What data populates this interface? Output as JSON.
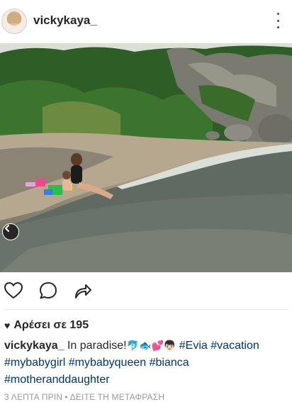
{
  "post": {
    "username": "vickykaya_",
    "likes_label": "Αρέσει σε 195",
    "caption": {
      "username": "vickykaya_",
      "text": "In paradise!",
      "emojis": "🐬🐟💕👦🏻",
      "hashtags": [
        "#Evia",
        "#vacation",
        "#mybabygirl",
        "#mybabyqueen",
        "#bianca",
        "#motheranddaughter"
      ]
    },
    "time_label": "3 ΛΕΠΤΑ ΠΡΙΝ",
    "translate_label": "ΔΕΙΤΕ ΤΗ ΜΕΤΑΦΡΑΣΗ",
    "separator": "•"
  },
  "icons": {
    "more": "more-options-icon",
    "like": "heart-outline-icon",
    "comment": "comment-bubble-icon",
    "share": "share-arrow-icon",
    "prev": "chevron-left-icon",
    "likes": "heart-filled-icon"
  },
  "colors": {
    "hashtag": "#003569",
    "meta": "#999999",
    "text": "#262626"
  }
}
